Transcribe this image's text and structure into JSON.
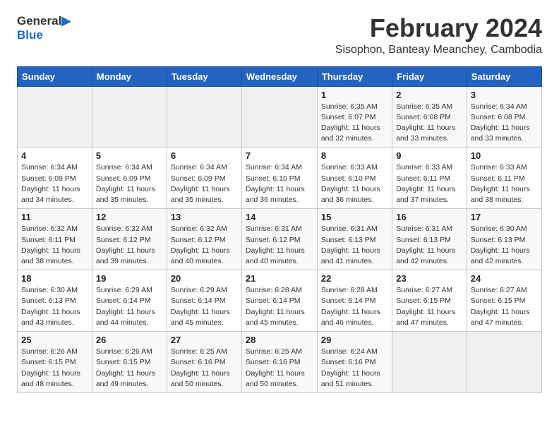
{
  "logo": {
    "line1": "General",
    "line2": "Blue"
  },
  "title": "February 2024",
  "subtitle": "Sisophon, Banteay Meanchey, Cambodia",
  "weekdays": [
    "Sunday",
    "Monday",
    "Tuesday",
    "Wednesday",
    "Thursday",
    "Friday",
    "Saturday"
  ],
  "weeks": [
    [
      {
        "day": "",
        "info": ""
      },
      {
        "day": "",
        "info": ""
      },
      {
        "day": "",
        "info": ""
      },
      {
        "day": "",
        "info": ""
      },
      {
        "day": "1",
        "info": "Sunrise: 6:35 AM\nSunset: 6:07 PM\nDaylight: 11 hours\nand 32 minutes."
      },
      {
        "day": "2",
        "info": "Sunrise: 6:35 AM\nSunset: 6:08 PM\nDaylight: 11 hours\nand 33 minutes."
      },
      {
        "day": "3",
        "info": "Sunrise: 6:34 AM\nSunset: 6:08 PM\nDaylight: 11 hours\nand 33 minutes."
      }
    ],
    [
      {
        "day": "4",
        "info": "Sunrise: 6:34 AM\nSunset: 6:09 PM\nDaylight: 11 hours\nand 34 minutes."
      },
      {
        "day": "5",
        "info": "Sunrise: 6:34 AM\nSunset: 6:09 PM\nDaylight: 11 hours\nand 35 minutes."
      },
      {
        "day": "6",
        "info": "Sunrise: 6:34 AM\nSunset: 6:09 PM\nDaylight: 11 hours\nand 35 minutes."
      },
      {
        "day": "7",
        "info": "Sunrise: 6:34 AM\nSunset: 6:10 PM\nDaylight: 11 hours\nand 36 minutes."
      },
      {
        "day": "8",
        "info": "Sunrise: 6:33 AM\nSunset: 6:10 PM\nDaylight: 11 hours\nand 36 minutes."
      },
      {
        "day": "9",
        "info": "Sunrise: 6:33 AM\nSunset: 6:11 PM\nDaylight: 11 hours\nand 37 minutes."
      },
      {
        "day": "10",
        "info": "Sunrise: 6:33 AM\nSunset: 6:11 PM\nDaylight: 11 hours\nand 38 minutes."
      }
    ],
    [
      {
        "day": "11",
        "info": "Sunrise: 6:32 AM\nSunset: 6:11 PM\nDaylight: 11 hours\nand 38 minutes."
      },
      {
        "day": "12",
        "info": "Sunrise: 6:32 AM\nSunset: 6:12 PM\nDaylight: 11 hours\nand 39 minutes."
      },
      {
        "day": "13",
        "info": "Sunrise: 6:32 AM\nSunset: 6:12 PM\nDaylight: 11 hours\nand 40 minutes."
      },
      {
        "day": "14",
        "info": "Sunrise: 6:31 AM\nSunset: 6:12 PM\nDaylight: 11 hours\nand 40 minutes."
      },
      {
        "day": "15",
        "info": "Sunrise: 6:31 AM\nSunset: 6:13 PM\nDaylight: 11 hours\nand 41 minutes."
      },
      {
        "day": "16",
        "info": "Sunrise: 6:31 AM\nSunset: 6:13 PM\nDaylight: 11 hours\nand 42 minutes."
      },
      {
        "day": "17",
        "info": "Sunrise: 6:30 AM\nSunset: 6:13 PM\nDaylight: 11 hours\nand 42 minutes."
      }
    ],
    [
      {
        "day": "18",
        "info": "Sunrise: 6:30 AM\nSunset: 6:13 PM\nDaylight: 11 hours\nand 43 minutes."
      },
      {
        "day": "19",
        "info": "Sunrise: 6:29 AM\nSunset: 6:14 PM\nDaylight: 11 hours\nand 44 minutes."
      },
      {
        "day": "20",
        "info": "Sunrise: 6:29 AM\nSunset: 6:14 PM\nDaylight: 11 hours\nand 45 minutes."
      },
      {
        "day": "21",
        "info": "Sunrise: 6:28 AM\nSunset: 6:14 PM\nDaylight: 11 hours\nand 45 minutes."
      },
      {
        "day": "22",
        "info": "Sunrise: 6:28 AM\nSunset: 6:14 PM\nDaylight: 11 hours\nand 46 minutes."
      },
      {
        "day": "23",
        "info": "Sunrise: 6:27 AM\nSunset: 6:15 PM\nDaylight: 11 hours\nand 47 minutes."
      },
      {
        "day": "24",
        "info": "Sunrise: 6:27 AM\nSunset: 6:15 PM\nDaylight: 11 hours\nand 47 minutes."
      }
    ],
    [
      {
        "day": "25",
        "info": "Sunrise: 6:26 AM\nSunset: 6:15 PM\nDaylight: 11 hours\nand 48 minutes."
      },
      {
        "day": "26",
        "info": "Sunrise: 6:26 AM\nSunset: 6:15 PM\nDaylight: 11 hours\nand 49 minutes."
      },
      {
        "day": "27",
        "info": "Sunrise: 6:25 AM\nSunset: 6:16 PM\nDaylight: 11 hours\nand 50 minutes."
      },
      {
        "day": "28",
        "info": "Sunrise: 6:25 AM\nSunset: 6:16 PM\nDaylight: 11 hours\nand 50 minutes."
      },
      {
        "day": "29",
        "info": "Sunrise: 6:24 AM\nSunset: 6:16 PM\nDaylight: 11 hours\nand 51 minutes."
      },
      {
        "day": "",
        "info": ""
      },
      {
        "day": "",
        "info": ""
      }
    ]
  ]
}
